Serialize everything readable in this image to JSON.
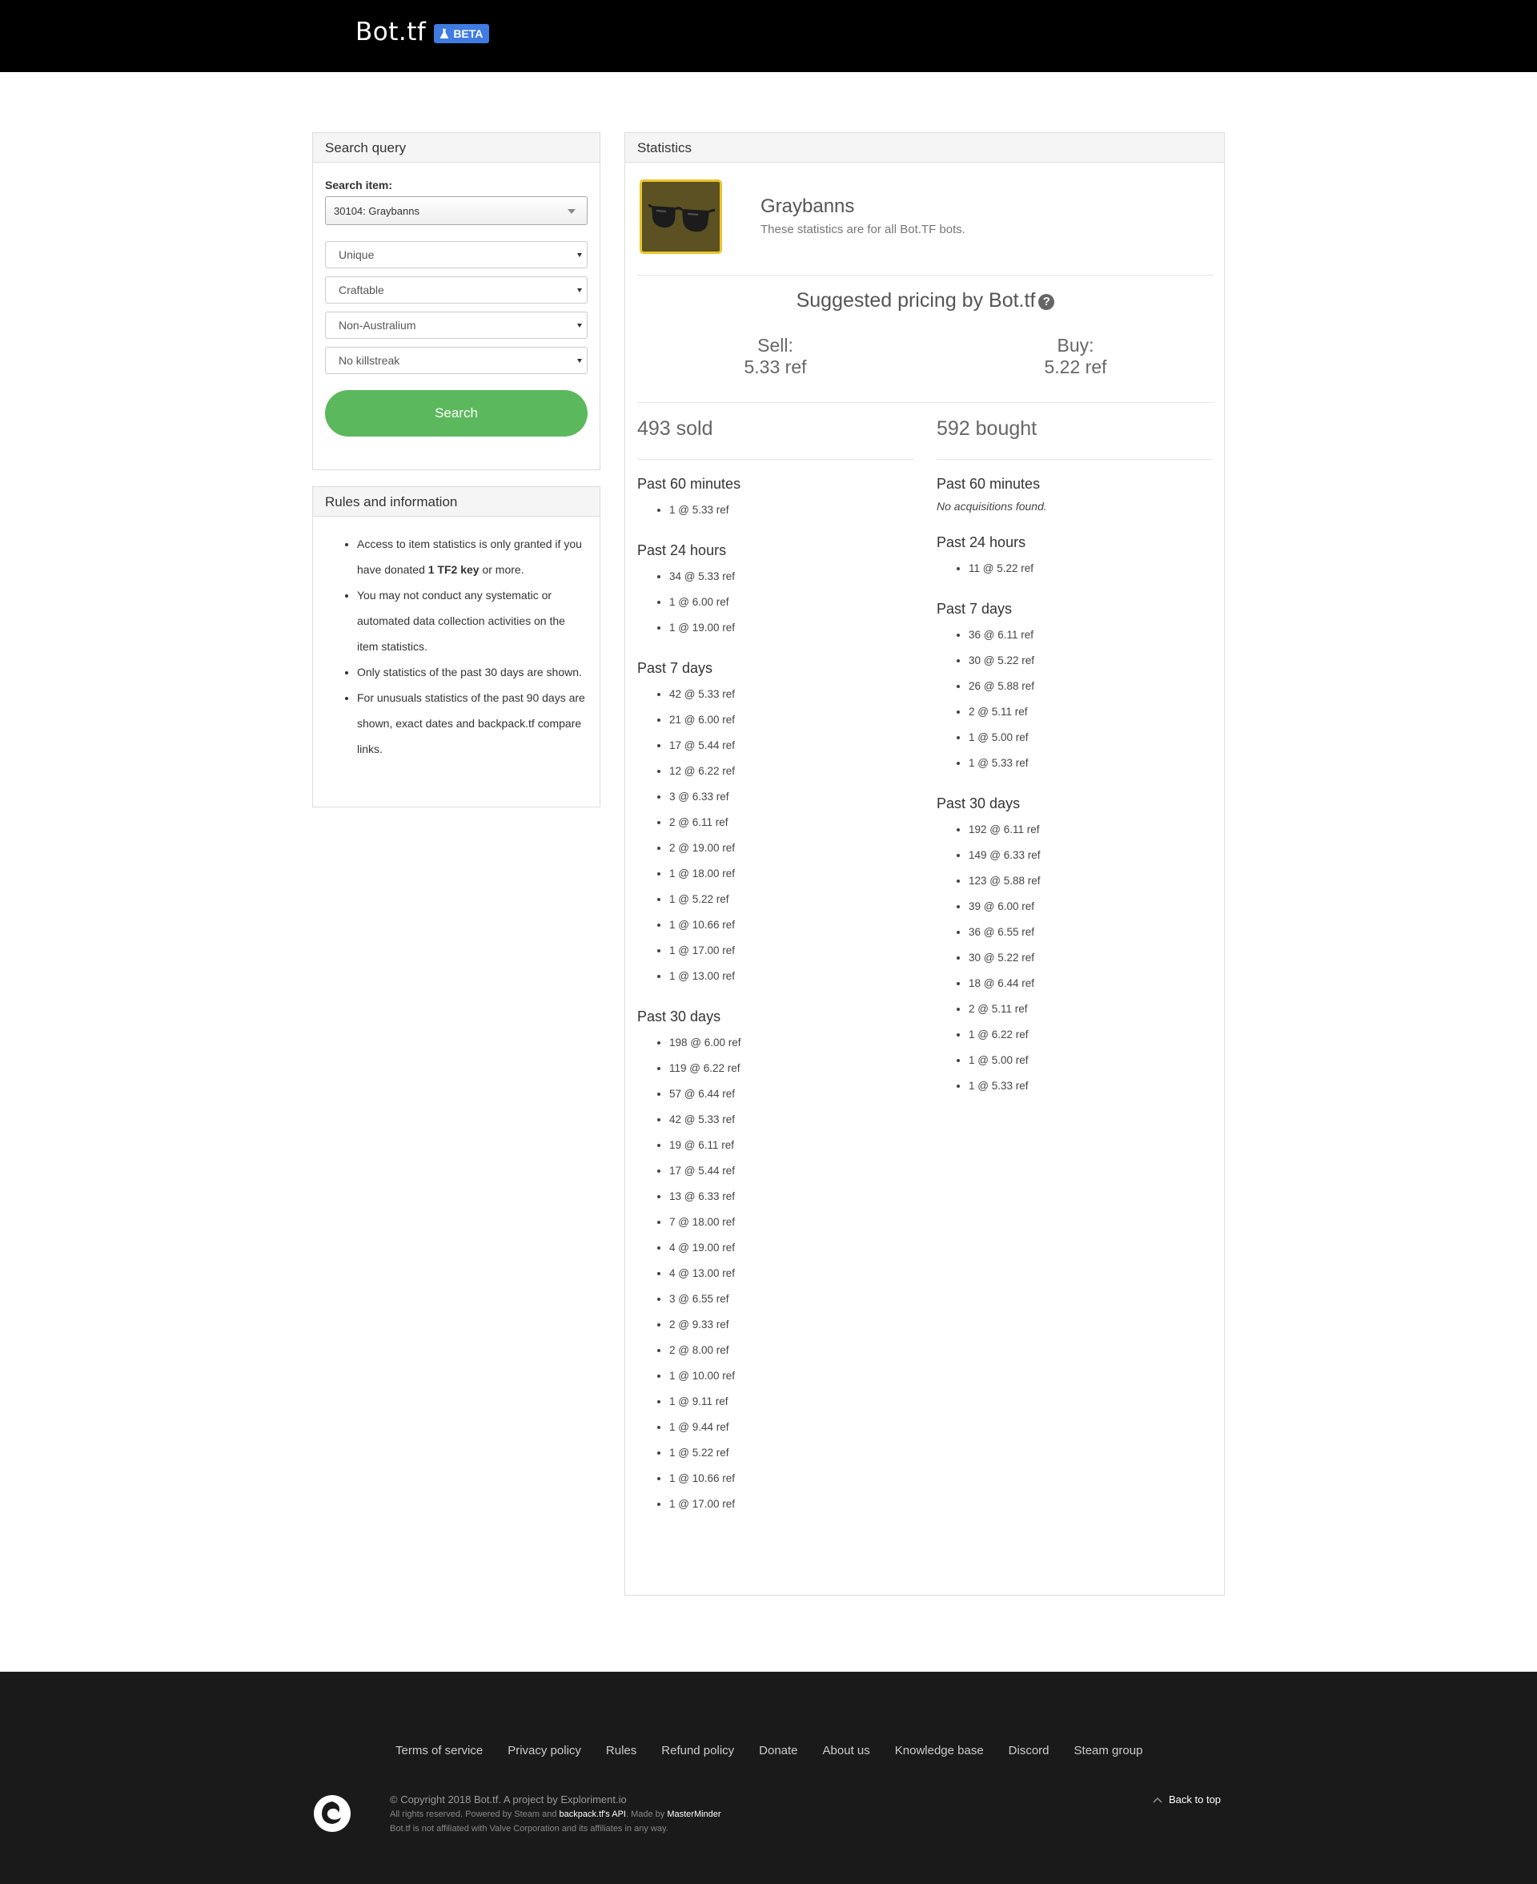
{
  "navbar": {
    "brand": "Bot.tf",
    "badge": "BETA"
  },
  "search_panel": {
    "title": "Search query",
    "item_label": "Search item:",
    "item_value": "30104: Graybanns",
    "quality": "Unique",
    "craftable": "Craftable",
    "australium": "Non-Australium",
    "killstreak": "No killstreak",
    "button": "Search"
  },
  "rules_panel": {
    "title": "Rules and information",
    "r1_pre": "Access to item statistics is only granted if you have donated ",
    "r1_bold": "1 TF2 key",
    "r1_post": " or more.",
    "r2": "You may not conduct any systematic or automated data collection activities on the item statistics.",
    "r3": "Only statistics of the past 30 days are shown.",
    "r4": "For unusuals statistics of the past 90 days are shown, exact dates and backpack.tf compare links."
  },
  "stats": {
    "title": "Statistics",
    "item_name": "Graybanns",
    "item_sub": "These statistics are for all Bot.TF bots.",
    "suggested": "Suggested pricing by Bot.tf",
    "sell_label": "Sell:",
    "sell_value": "5.33 ref",
    "buy_label": "Buy:",
    "buy_value": "5.22 ref",
    "sold": {
      "total": "493 sold",
      "periods": [
        {
          "title": "Past 60 minutes",
          "entries": [
            "1 @ 5.33 ref"
          ]
        },
        {
          "title": "Past 24 hours",
          "entries": [
            "34 @ 5.33 ref",
            "1 @ 6.00 ref",
            "1 @ 19.00 ref"
          ]
        },
        {
          "title": "Past 7 days",
          "entries": [
            "42 @ 5.33 ref",
            "21 @ 6.00 ref",
            "17 @ 5.44 ref",
            "12 @ 6.22 ref",
            "3 @ 6.33 ref",
            "2 @ 6.11 ref",
            "2 @ 19.00 ref",
            "1 @ 18.00 ref",
            "1 @ 5.22 ref",
            "1 @ 10.66 ref",
            "1 @ 17.00 ref",
            "1 @ 13.00 ref"
          ]
        },
        {
          "title": "Past 30 days",
          "entries": [
            "198 @ 6.00 ref",
            "119 @ 6.22 ref",
            "57 @ 6.44 ref",
            "42 @ 5.33 ref",
            "19 @ 6.11 ref",
            "17 @ 5.44 ref",
            "13 @ 6.33 ref",
            "7 @ 18.00 ref",
            "4 @ 19.00 ref",
            "4 @ 13.00 ref",
            "3 @ 6.55 ref",
            "2 @ 9.33 ref",
            "2 @ 8.00 ref",
            "1 @ 10.00 ref",
            "1 @ 9.11 ref",
            "1 @ 9.44 ref",
            "1 @ 5.22 ref",
            "1 @ 10.66 ref",
            "1 @ 17.00 ref"
          ]
        }
      ]
    },
    "bought": {
      "total": "592 bought",
      "periods": [
        {
          "title": "Past 60 minutes",
          "empty": "No acquisitions found.",
          "entries": []
        },
        {
          "title": "Past 24 hours",
          "entries": [
            "11 @ 5.22 ref"
          ]
        },
        {
          "title": "Past 7 days",
          "entries": [
            "36 @ 6.11 ref",
            "30 @ 5.22 ref",
            "26 @ 5.88 ref",
            "2 @ 5.11 ref",
            "1 @ 5.00 ref",
            "1 @ 5.33 ref"
          ]
        },
        {
          "title": "Past 30 days",
          "entries": [
            "192 @ 6.11 ref",
            "149 @ 6.33 ref",
            "123 @ 5.88 ref",
            "39 @ 6.00 ref",
            "36 @ 6.55 ref",
            "30 @ 5.22 ref",
            "18 @ 6.44 ref",
            "2 @ 5.11 ref",
            "1 @ 6.22 ref",
            "1 @ 5.00 ref",
            "1 @ 5.33 ref"
          ]
        }
      ]
    }
  },
  "footer": {
    "links": [
      "Terms of service",
      "Privacy policy",
      "Rules",
      "Refund policy",
      "Donate",
      "About us",
      "Knowledge base",
      "Discord",
      "Steam group"
    ],
    "copyright": "© Copyright 2018 Bot.tf. A project by Exploriment.io",
    "rights_pre": "All rights reserved. Powered by Steam and ",
    "rights_link": "backpack.tf's API",
    "rights_mid": ". Made by ",
    "rights_author": "MasterMinder",
    "disclaimer": "Bot.tf is not affiliated with Valve Corporation and its affiliates in any way.",
    "back_to_top": "Back to top"
  },
  "colors": {
    "navbar": "#000000",
    "badge": "#3f7be0",
    "search_button": "#5cb85c",
    "footer": "#1a1a1a",
    "item_border": "#e7c52d"
  },
  "icons": [
    "flask-icon",
    "chevron-down-icon",
    "caret-down-icon",
    "question-circle-icon",
    "chevron-up-icon",
    "exploriment-logo",
    "sunglasses-item-image"
  ]
}
